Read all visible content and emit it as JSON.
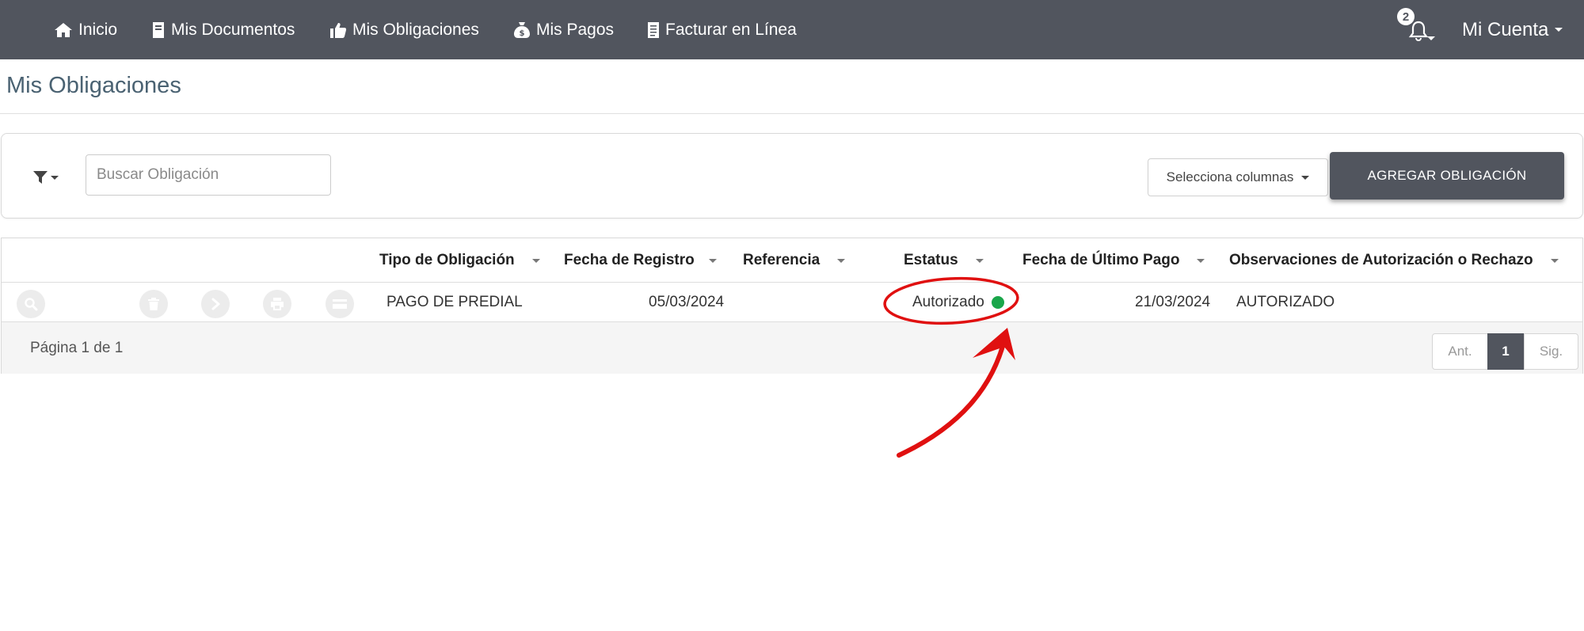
{
  "nav": {
    "items": [
      {
        "label": "Inicio",
        "icon": "home-icon"
      },
      {
        "label": "Mis Documentos",
        "icon": "book-icon"
      },
      {
        "label": "Mis Obligaciones",
        "icon": "thumbs-up-icon"
      },
      {
        "label": "Mis Pagos",
        "icon": "money-bag-icon"
      },
      {
        "label": "Facturar en Línea",
        "icon": "receipt-icon"
      }
    ],
    "notifications_count": "2",
    "account_label": "Mi Cuenta"
  },
  "page": {
    "title": "Mis Obligaciones"
  },
  "toolbar": {
    "search_placeholder": "Buscar Obligación",
    "columns_label": "Selecciona columnas",
    "add_button": "AGREGAR OBLIGACIÓN"
  },
  "table": {
    "columns": [
      "Tipo de Obligación",
      "Fecha de Registro",
      "Referencia",
      "Estatus",
      "Fecha de Último Pago",
      "Observaciones de Autorización o Rechazo"
    ],
    "row_actions": [
      "search-icon",
      "trash-icon",
      "arrow-right-icon",
      "print-icon",
      "card-icon"
    ],
    "rows": [
      {
        "tipo": "PAGO DE PREDIAL",
        "fecha_registro": "05/03/2024",
        "referencia": "",
        "estatus": "Autorizado",
        "estatus_color": "#1aa64a",
        "fecha_ultimo_pago": "21/03/2024",
        "observaciones": "AUTORIZADO"
      }
    ]
  },
  "pagination": {
    "info": "Página 1 de 1",
    "prev": "Ant.",
    "current": "1",
    "next": "Sig."
  },
  "colors": {
    "nav_bg": "#51555e",
    "annotation": "#e01010",
    "status_ok": "#1aa64a"
  }
}
